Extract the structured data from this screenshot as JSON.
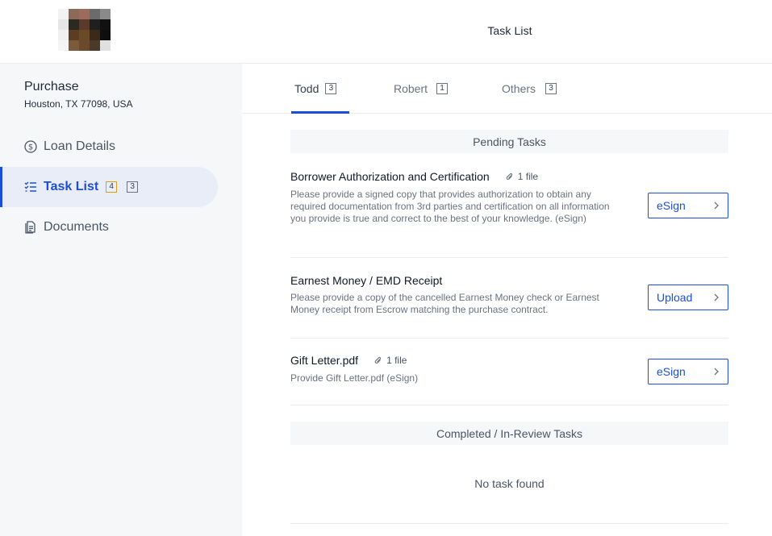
{
  "header": {
    "page_title": "Task List",
    "avatar_colors": [
      "#f2f2f2",
      "#8b6a5a",
      "#9b6b5e",
      "#6b6b6b",
      "#8a8a8a",
      "#e6e6e6",
      "#2a2a22",
      "#5a3a2a",
      "#1f1f1f",
      "#111111",
      "#f0f0f0",
      "#5b3e22",
      "#6b4a2a",
      "#3a2a1a",
      "#0e0e0e",
      "#f4f4f4",
      "#7a5a3a",
      "#6a4a2a",
      "#4a3a2a",
      "#e0e0e0"
    ]
  },
  "sidebar": {
    "loan_type": "Purchase",
    "address": "Houston, TX 77098, USA",
    "items": [
      {
        "label": "Loan Details",
        "icon": "dollar-circle-icon"
      },
      {
        "label": "Task List",
        "icon": "checklist-icon",
        "count_pending": "4",
        "count_other": "3"
      },
      {
        "label": "Documents",
        "icon": "documents-icon"
      }
    ]
  },
  "tabs": [
    {
      "label": "Todd",
      "count": "3"
    },
    {
      "label": "Robert",
      "count": "1"
    },
    {
      "label": "Others",
      "count": "3"
    }
  ],
  "pending": {
    "header": "Pending Tasks",
    "tasks": [
      {
        "title": "Borrower Authorization and Certification",
        "attachment": "1 file",
        "description": "Please provide a signed copy that provides authorization to obtain any required documentation from 3rd parties and certification on all information you provide is true and correct to the best of your knowledge. (eSign)",
        "action": "eSign"
      },
      {
        "title": "Earnest Money / EMD Receipt",
        "description": "Please provide a copy of the cancelled Earnest Money check or Earnest Money receipt from Escrow matching the purchase contract.",
        "action": "Upload"
      },
      {
        "title": "Gift Letter.pdf",
        "attachment": "1 file",
        "description": "Provide Gift Letter.pdf (eSign)",
        "action": "eSign"
      }
    ]
  },
  "completed": {
    "header": "Completed / In-Review Tasks",
    "empty_message": "No task found"
  },
  "colors": {
    "accent": "#1d4ed8",
    "sidebar_bg": "#f6f7f9",
    "badge_warn": "#d4a017"
  }
}
